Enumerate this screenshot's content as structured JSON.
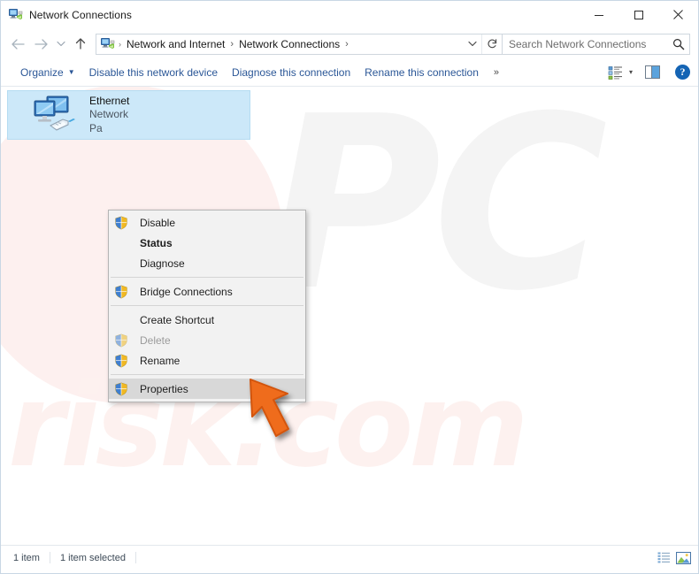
{
  "window": {
    "title": "Network Connections",
    "icon": "network-connections-icon",
    "controls": {
      "minimize": "minimize-icon",
      "maximize": "maximize-icon",
      "close": "close-icon"
    }
  },
  "navbar": {
    "back": "back-arrow-icon",
    "forward": "forward-arrow-icon",
    "recent": "recent-locations-chevron-icon",
    "up": "up-arrow-icon",
    "address": {
      "icon": "network-connections-icon",
      "crumbs": [
        "Network and Internet",
        "Network Connections"
      ],
      "separator": "›",
      "leading_separator": "›",
      "dropdown": "address-dropdown-icon",
      "refresh": "refresh-icon"
    },
    "search": {
      "placeholder": "Search Network Connections",
      "value": "",
      "icon": "search-icon"
    }
  },
  "commandbar": {
    "items": [
      {
        "label": "Organize",
        "has_caret": true
      },
      {
        "label": "Disable this network device",
        "has_caret": false
      },
      {
        "label": "Diagnose this connection",
        "has_caret": false
      },
      {
        "label": "Rename this connection",
        "has_caret": false
      }
    ],
    "overflow": "»",
    "view_options_icon": "change-view-icon",
    "view_options_caret": "▾",
    "preview_pane_icon": "preview-pane-icon",
    "help_label": "?",
    "help_icon": "help-icon"
  },
  "content": {
    "item": {
      "name": "Ethernet",
      "sub1": "Network",
      "sub2": "Pa",
      "icon": "ethernet-adapter-icon"
    }
  },
  "context_menu": {
    "items": [
      {
        "type": "item",
        "label": "Disable",
        "shield": true,
        "bold": false,
        "disabled": false,
        "hovered": false
      },
      {
        "type": "item",
        "label": "Status",
        "shield": false,
        "bold": true,
        "disabled": false,
        "hovered": false
      },
      {
        "type": "item",
        "label": "Diagnose",
        "shield": false,
        "bold": false,
        "disabled": false,
        "hovered": false
      },
      {
        "type": "separator"
      },
      {
        "type": "item",
        "label": "Bridge Connections",
        "shield": true,
        "bold": false,
        "disabled": false,
        "hovered": false
      },
      {
        "type": "separator"
      },
      {
        "type": "item",
        "label": "Create Shortcut",
        "shield": false,
        "bold": false,
        "disabled": false,
        "hovered": false
      },
      {
        "type": "item",
        "label": "Delete",
        "shield": true,
        "bold": false,
        "disabled": true,
        "hovered": false
      },
      {
        "type": "item",
        "label": "Rename",
        "shield": true,
        "bold": false,
        "disabled": false,
        "hovered": false
      },
      {
        "type": "separator"
      },
      {
        "type": "item",
        "label": "Properties",
        "shield": true,
        "bold": false,
        "disabled": false,
        "hovered": true
      }
    ]
  },
  "cursor": {
    "icon": "orange-arrow-pointer-icon"
  },
  "statusbar": {
    "item_count": "1 item",
    "selection": "1 item selected",
    "details_view_icon": "details-view-icon",
    "large_icons_view_icon": "large-icons-view-icon"
  },
  "watermark": {
    "big": "PC",
    "small": "risk.com"
  },
  "colors": {
    "accent_link": "#2b5797",
    "selection": "#cce8f9",
    "help_blue": "#1464b4",
    "cursor_orange": "#ef6c1f",
    "menu_bg": "#f2f2f2",
    "menu_hover": "#d8d8d8"
  }
}
